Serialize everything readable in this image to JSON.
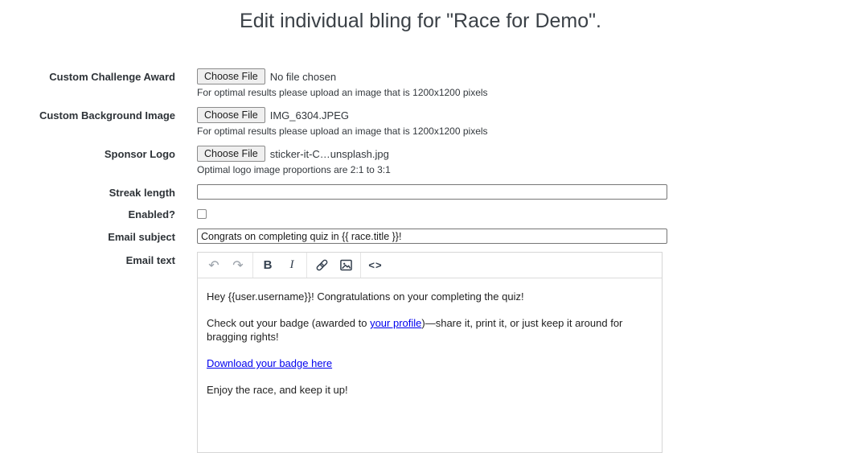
{
  "title": "Edit individual bling for \"Race for Demo\".",
  "form": {
    "challenge_award": {
      "label": "Custom Challenge Award",
      "button": "Choose File",
      "filename": "No file chosen",
      "helper": "For optimal results please upload an image that is 1200x1200 pixels"
    },
    "background_image": {
      "label": "Custom Background Image",
      "button": "Choose File",
      "filename": "IMG_6304.JPEG",
      "helper": "For optimal results please upload an image that is 1200x1200 pixels"
    },
    "sponsor_logo": {
      "label": "Sponsor Logo",
      "button": "Choose File",
      "filename": "sticker-it-C…unsplash.jpg",
      "helper": "Optimal logo image proportions are 2:1 to 3:1"
    },
    "streak_length": {
      "label": "Streak length",
      "value": ""
    },
    "enabled": {
      "label": "Enabled?",
      "checked": false
    },
    "email_subject": {
      "label": "Email subject",
      "value": "Congrats on completing quiz in {{ race.title }}!"
    },
    "email_text": {
      "label": "Email text",
      "toolbar": {
        "undo": "↶",
        "redo": "↷",
        "bold": "B",
        "italic": "I",
        "code": "<>"
      },
      "paragraphs": {
        "p1": "Hey {{user.username}}! Congratulations on your completing the quiz!",
        "p2_before": "Check out your badge (awarded to ",
        "p2_link": "your profile",
        "p2_after": ")—share it, print it, or just keep it around for bragging rights!",
        "p3_link": "Download your badge here",
        "p4": "Enjoy the race, and keep it up!"
      }
    }
  },
  "colors": {
    "link": "#0000ee",
    "title_text": "#3b4147",
    "label_text": "#2e3338",
    "toolbar_icon": "#34404f",
    "toolbar_icon_muted": "#9aa1a9"
  }
}
